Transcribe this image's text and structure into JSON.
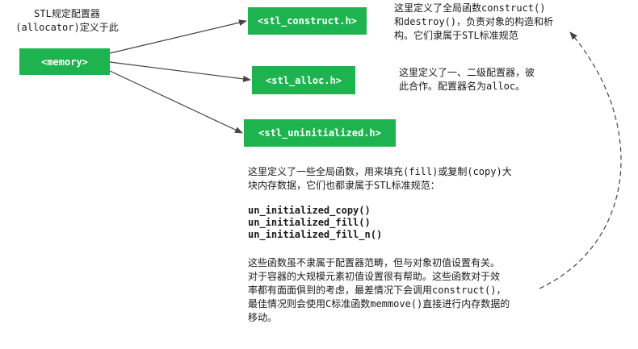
{
  "header_note": "STL规定配置器\n(allocator)定义于此",
  "boxes": {
    "memory": "<memory>",
    "construct": "<stl_construct.h>",
    "alloc": "<stl_alloc.h>",
    "uninitialized": "<stl_uninitialized.h>"
  },
  "notes": {
    "construct": "这里定义了全局函数construct()\n和destroy()，负责对象的构造和析\n构。它们隶属于STL标准规范",
    "alloc": "这里定义了一、二级配置器，彼\n此合作。配置器名为alloc。",
    "uninit_intro": "这里定义了一些全局函数，用来填充(fill)或复制(copy)大\n块内存数据，它们也都隶属于STL标准规范：",
    "uninit_detail": "这些函数虽不隶属于配置器范畴，但与对象初值设置有关。\n对于容器的大规模元素初值设置很有帮助。这些函数对于效\n率都有面面俱到的考虑，最差情况下会调用construct()，\n最佳情况则会使用C标准函数memmove()直接进行内存数据的\n移动。"
  },
  "functions": [
    "un_initialized_copy()",
    "un_initialized_fill()",
    "un_initialized_fill_n()"
  ],
  "colors": {
    "box_fill": "#1db34f",
    "box_text": "#ffffff",
    "arrow": "#444444"
  }
}
